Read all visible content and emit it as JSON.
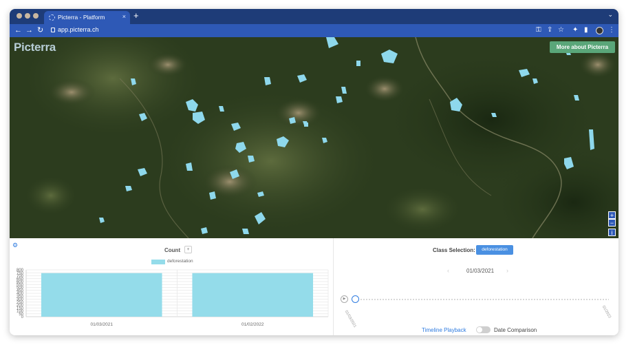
{
  "browser": {
    "tab_title": "Picterra - Platform",
    "tab_close": "×",
    "new_tab": "+",
    "tabs_menu": "⌄",
    "url": "app.picterra.ch",
    "nav": {
      "back": "←",
      "forward": "→",
      "reload": "↻"
    },
    "toolbar_icons": {
      "key": "⚿",
      "share": "⇪",
      "star": "☆",
      "extensions": "✦",
      "sidebar": "▮",
      "menu": "⋮"
    }
  },
  "map": {
    "logo": "Picterra",
    "about_button": "More about Picterra",
    "zoom_in": "+",
    "zoom_out": "−",
    "info": "i",
    "detection_color": "#8ed8ec"
  },
  "chart_panel": {
    "settings_icon": "⚙",
    "title": "Count",
    "title_button": "+",
    "legend": "deforestation"
  },
  "chart_data": {
    "type": "bar",
    "categories": [
      "01/03/2021",
      "01/02/2022"
    ],
    "series": [
      {
        "name": "deforestation",
        "values": [
          745,
          745
        ]
      }
    ],
    "ylim": [
      0,
      800
    ],
    "yticks": [
      0,
      50,
      100,
      150,
      200,
      250,
      300,
      350,
      400,
      450,
      500,
      550,
      600,
      650,
      700,
      750,
      800
    ],
    "grid": true,
    "legend_position": "top",
    "bar_color": "#94dcea"
  },
  "timeline_panel": {
    "class_selection_label": "Class Selection:",
    "class_button": "deforestation",
    "prev_arrow": "‹",
    "next_arrow": "›",
    "current_date": "01/03/2021",
    "play_icon": "▶",
    "start_tick": "01/03/2021",
    "end_tick": "01/2022",
    "timeline_playback": "Timeline Playback",
    "date_comparison": "Date Comparison"
  }
}
